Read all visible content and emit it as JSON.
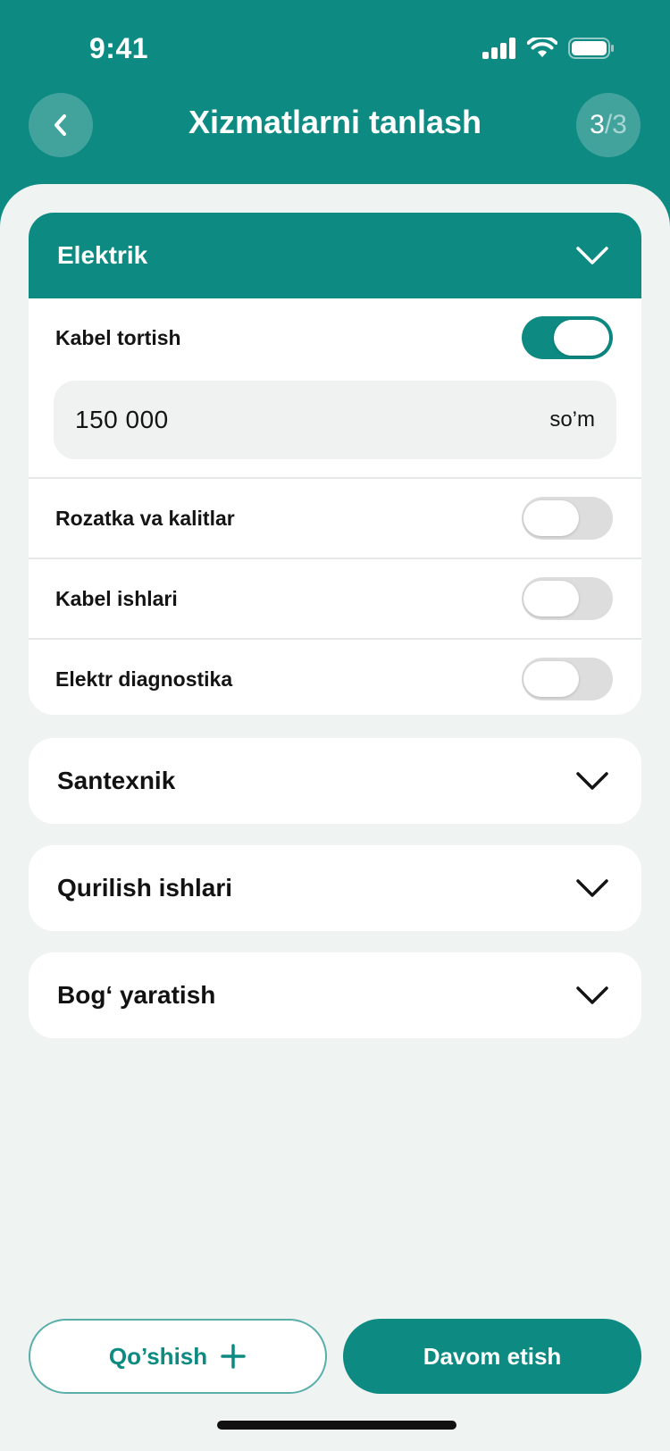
{
  "status_bar": {
    "time": "9:41"
  },
  "header": {
    "title": "Xizmatlarni tanlash",
    "step_current": "3",
    "step_rest": "/3"
  },
  "sections": {
    "elektrik": {
      "title": "Elektrik",
      "expanded": true,
      "items": [
        {
          "label": "Kabel tortish",
          "enabled": true,
          "price": "150 000",
          "unit": "so’m"
        },
        {
          "label": "Rozatka va kalitlar",
          "enabled": false
        },
        {
          "label": "Kabel ishlari",
          "enabled": false
        },
        {
          "label": "Elektr diagnostika",
          "enabled": false
        }
      ]
    },
    "santexnik": {
      "title": "Santexnik",
      "expanded": false
    },
    "qurilish": {
      "title": "Qurilish ishlari",
      "expanded": false
    },
    "bog": {
      "title": "Bog‘ yaratish",
      "expanded": false
    }
  },
  "actions": {
    "add_label": "Qo’shish",
    "continue_label": "Davom etish"
  },
  "colors": {
    "primary": "#0d8a82",
    "background": "#eff3f2",
    "toggle_off": "#dddddd"
  },
  "icons": [
    "back-chevron-icon",
    "signal-icon",
    "wifi-icon",
    "battery-icon",
    "chevron-down-icon",
    "plus-icon"
  ]
}
